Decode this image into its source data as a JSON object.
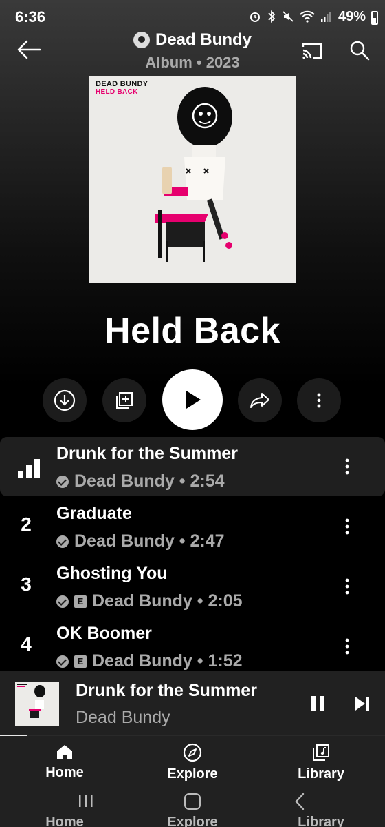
{
  "status_bar": {
    "time": "6:36",
    "battery": "49%"
  },
  "header": {
    "artist": "Dead Bundy",
    "subtitle": "Album • 2023"
  },
  "cover": {
    "band": "DEAD BUNDY",
    "title": "HELD BACK"
  },
  "album": {
    "title": "Held Back"
  },
  "tracks": [
    {
      "number": "",
      "title": "Drunk for the Summer",
      "meta": "Dead Bundy • 2:54",
      "explicit": false,
      "playing": true
    },
    {
      "number": "2",
      "title": "Graduate",
      "meta": "Dead Bundy • 2:47",
      "explicit": false,
      "playing": false
    },
    {
      "number": "3",
      "title": "Ghosting You",
      "meta": "Dead Bundy • 2:05",
      "explicit": true,
      "playing": false
    },
    {
      "number": "4",
      "title": "OK Boomer",
      "meta": "Dead Bundy • 1:52",
      "explicit": true,
      "playing": false
    }
  ],
  "mini_player": {
    "title": "Drunk for the Summer",
    "artist": "Dead Bundy",
    "progress": 0.07
  },
  "nav": {
    "home": "Home",
    "explore": "Explore",
    "library": "Library"
  },
  "explicit_badge": "E",
  "colors": {
    "accent_play": "#ffffff",
    "active_row": "#1f1f1f",
    "muted_text": "#aaaaaa",
    "cover_pink": "#e6006e"
  },
  "icons": [
    "back-arrow-icon",
    "cast-icon",
    "search-icon",
    "download-icon",
    "add-to-library-icon",
    "play-icon",
    "share-icon",
    "more-vert-icon",
    "equalizer-bars-icon",
    "verified-check-icon",
    "explicit-icon",
    "pause-icon",
    "skip-next-icon",
    "home-icon",
    "compass-icon",
    "library-icon"
  ]
}
